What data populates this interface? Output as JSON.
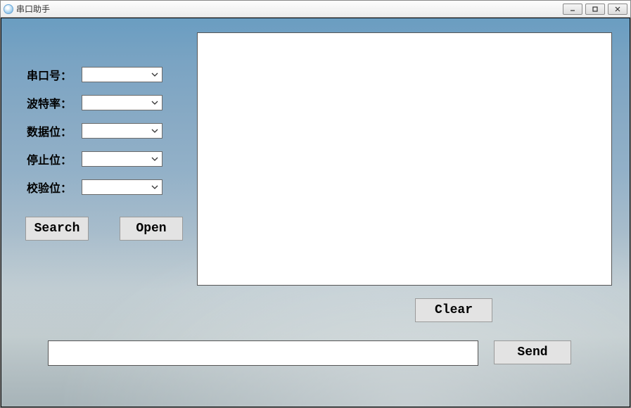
{
  "window": {
    "title": "串口助手"
  },
  "form": {
    "port_label": "串口号：",
    "baud_label": "波特率：",
    "data_bits_label": "数据位：",
    "stop_bits_label": "停止位：",
    "parity_label": "校验位：",
    "port_value": "",
    "baud_value": "",
    "data_bits_value": "",
    "stop_bits_value": "",
    "parity_value": ""
  },
  "buttons": {
    "search": "Search",
    "open": "Open",
    "clear": "Clear",
    "send": "Send"
  },
  "receive_text": "",
  "send_text": ""
}
